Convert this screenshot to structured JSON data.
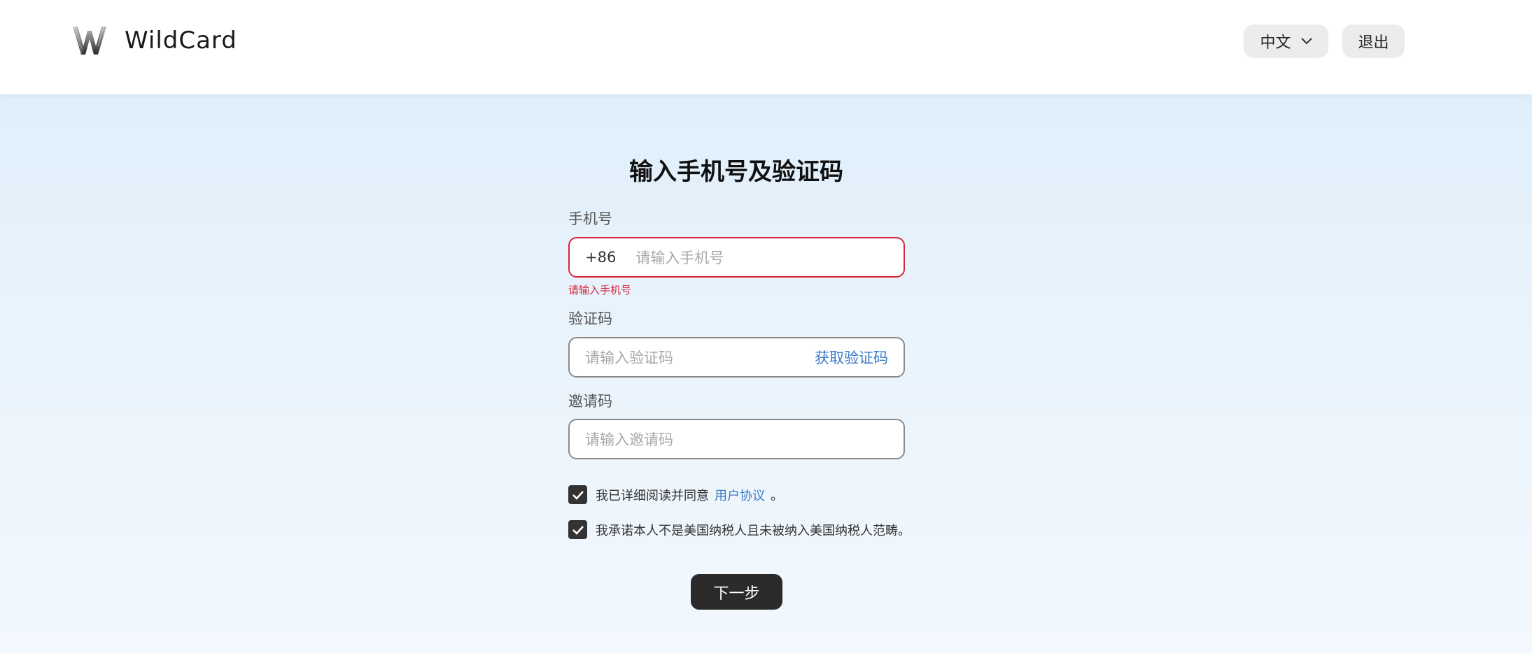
{
  "header": {
    "app_name": "WildCard",
    "logo_icon": "wildcard-w-logo",
    "language_label": "中文",
    "logout_label": "退出"
  },
  "form": {
    "title": "输入手机号及验证码",
    "phone": {
      "label": "手机号",
      "country_code": "+86",
      "placeholder": "请输入手机号",
      "error": "请输入手机号"
    },
    "code": {
      "label": "验证码",
      "placeholder": "请输入验证码",
      "get_code_label": "获取验证码"
    },
    "invite": {
      "label": "邀请码",
      "placeholder": "请输入邀请码"
    },
    "agreement": {
      "checked": true,
      "text": "我已详细阅读并同意",
      "link_text": "用户协议",
      "suffix": "。"
    },
    "tax_declaration": {
      "checked": true,
      "text": "我承诺本人不是美国纳税人且未被纳入美国纳税人范畴。"
    },
    "next_label": "下一步"
  },
  "colors": {
    "error": "#d7263d",
    "link": "#3a7bc8",
    "primary_button": "#2b2b2b"
  }
}
